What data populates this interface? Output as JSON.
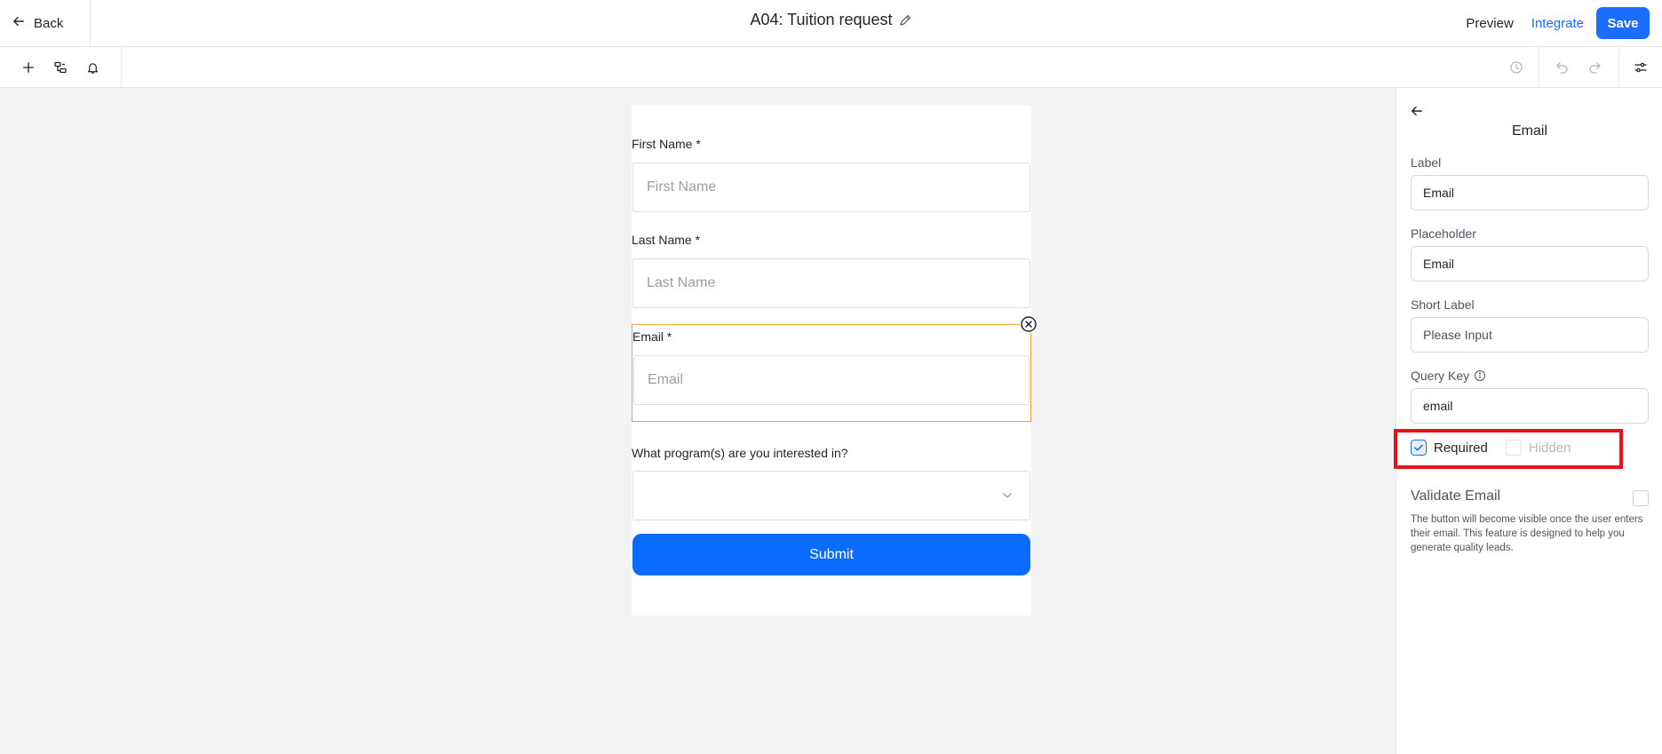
{
  "header": {
    "back_label": "Back",
    "title": "A04: Tuition request",
    "preview_label": "Preview",
    "integrate_label": "Integrate",
    "save_label": "Save"
  },
  "toolbar": {
    "left_icons": [
      "plus-icon",
      "structure-icon",
      "bell-icon"
    ],
    "right_icons": [
      "history-icon",
      "undo-icon",
      "redo-icon",
      "settings-sliders-icon"
    ]
  },
  "form": {
    "fields": [
      {
        "label": "First Name",
        "required_mark": "*",
        "placeholder": "First Name"
      },
      {
        "label": "Last Name",
        "required_mark": "*",
        "placeholder": "Last Name"
      },
      {
        "label": "Email",
        "required_mark": "*",
        "placeholder": "Email"
      },
      {
        "label": "What program(s) are you interested in?",
        "value": ""
      }
    ],
    "submit_label": "Submit"
  },
  "panel": {
    "title": "Email",
    "label_caption": "Label",
    "label_value": "Email",
    "placeholder_caption": "Placeholder",
    "placeholder_value": "Email",
    "short_label_caption": "Short Label",
    "short_label_placeholder": "Please Input",
    "query_key_caption": "Query Key",
    "query_key_value": "email",
    "required_label": "Required",
    "required_checked": true,
    "hidden_label": "Hidden",
    "hidden_checked": false,
    "validate_label": "Validate Email",
    "validate_checked": false,
    "validate_desc": "The button will become visible once the user enters their email. This feature is designed to help you generate quality leads."
  },
  "colors": {
    "accent": "#1a6dff",
    "selection_outline": "#f0a030",
    "highlight": "#e8101a",
    "canvas_bg": "#f2f3f5"
  }
}
